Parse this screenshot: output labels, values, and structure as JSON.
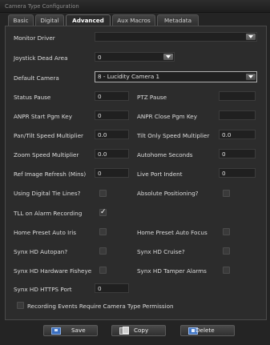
{
  "window": {
    "title": "Camera Type Configuration"
  },
  "tabs": [
    {
      "label": "Basic",
      "active": false
    },
    {
      "label": "Digital",
      "active": false
    },
    {
      "label": "Advanced",
      "active": true
    },
    {
      "label": "Aux Macros",
      "active": false
    },
    {
      "label": "Metadata",
      "active": false
    }
  ],
  "form": {
    "monitor_driver": {
      "label": "Monitor Driver",
      "value": ""
    },
    "joystick_dead_area": {
      "label": "Joystick Dead Area",
      "value": "0"
    },
    "default_camera": {
      "label": "Default Camera",
      "value": "8 - Lucidity Camera 1"
    },
    "status_pause": {
      "label": "Status Pause",
      "value": "0"
    },
    "ptz_pause": {
      "label": "PTZ Pause",
      "value": ""
    },
    "anpr_start_pgm_key": {
      "label": "ANPR Start Pgm Key",
      "value": "0"
    },
    "anpr_close_pgm_key": {
      "label": "ANPR Close Pgm Key",
      "value": ""
    },
    "pan_tilt_speed_multiplier": {
      "label": "Pan/Tilt Speed Multiplier",
      "value": "0.0"
    },
    "tilt_only_speed_multiplier": {
      "label": "Tilt Only Speed Multiplier",
      "value": "0.0"
    },
    "zoom_speed_multiplier": {
      "label": "Zoom Speed Multiplier",
      "value": "0.0"
    },
    "autohome_seconds": {
      "label": "Autohome Seconds",
      "value": "0"
    },
    "ref_image_refresh": {
      "label": "Ref Image Refresh (Mins)",
      "value": "0"
    },
    "live_port_indent": {
      "label": "Live Port Indent",
      "value": "0"
    },
    "using_digital_tie_lines": {
      "label": "Using Digital Tie Lines?",
      "checked": false
    },
    "absolute_positioning": {
      "label": "Absolute Positioning?",
      "checked": false
    },
    "tll_on_alarm_recording": {
      "label": "TLL on Alarm Recording",
      "checked": true
    },
    "home_preset_auto_iris": {
      "label": "Home Preset Auto Iris",
      "checked": false
    },
    "home_preset_auto_focus": {
      "label": "Home Preset Auto Focus",
      "checked": false
    },
    "synx_hd_autopan": {
      "label": "Synx HD Autopan?",
      "checked": false
    },
    "synx_hd_cruise": {
      "label": "Synx HD Cruise?",
      "checked": false
    },
    "synx_hd_hardware_fisheye": {
      "label": "Synx HD Hardware Fisheye",
      "checked": false
    },
    "synx_hd_tamper_alarms": {
      "label": "Synx HD Tamper Alarms",
      "checked": false
    },
    "synx_hd_https_port": {
      "label": "Synx HD HTTPS Port",
      "value": "0"
    },
    "recording_events_permission": {
      "label": "Recording Events Require Camera Type Permission",
      "checked": false
    }
  },
  "check_mark": "✓",
  "buttons": {
    "save": "Save",
    "copy": "Copy",
    "delete": "Delete"
  },
  "colors": {
    "background": "#242424",
    "panel": "#2c2c2c",
    "input": "#202020",
    "text": "#dcdcdc"
  }
}
